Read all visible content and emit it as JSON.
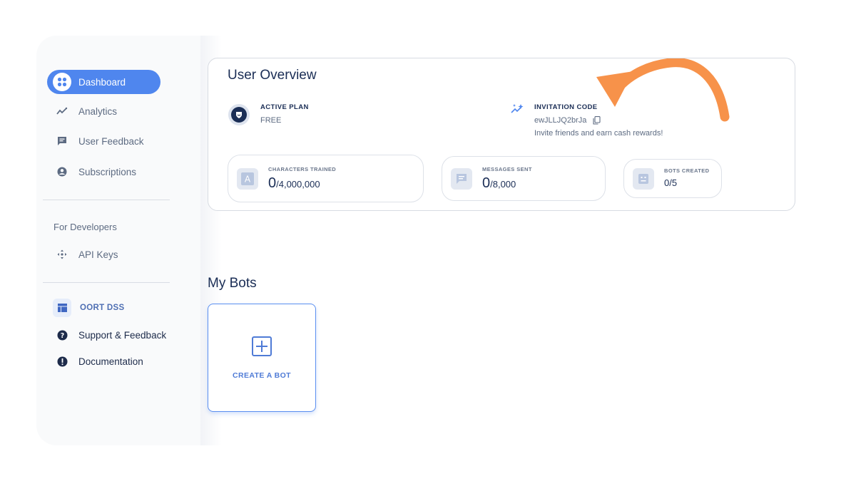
{
  "sidebar": {
    "nav": [
      {
        "label": "Dashboard",
        "icon": "dashboard-icon",
        "active": true
      },
      {
        "label": "Analytics",
        "icon": "analytics-icon"
      },
      {
        "label": "User Feedback",
        "icon": "feedback-icon"
      },
      {
        "label": "Subscriptions",
        "icon": "account-icon"
      }
    ],
    "developers_heading": "For Developers",
    "api_keys": "API Keys",
    "oort_dss": "OORT DSS",
    "support": "Support & Feedback",
    "documentation": "Documentation"
  },
  "overview": {
    "title": "User Overview",
    "active_plan": {
      "label": "ACTIVE PLAN",
      "value": "FREE"
    },
    "invitation": {
      "label": "INVITATION CODE",
      "code": "ewJLLJQ2brJa",
      "note": "Invite friends and earn cash rewards!"
    },
    "stats": [
      {
        "label": "CHARACTERS TRAINED",
        "value": "0",
        "total": "/4,000,000"
      },
      {
        "label": "MESSAGES SENT",
        "value": "0",
        "total": "/8,000"
      },
      {
        "label": "BOTS CREATED",
        "value": "0/5"
      }
    ]
  },
  "bots": {
    "title": "My Bots",
    "create_label": "CREATE A BOT"
  },
  "colors": {
    "accent": "#4f86ee",
    "navy": "#1a2d55",
    "arrow": "#f7924a"
  }
}
